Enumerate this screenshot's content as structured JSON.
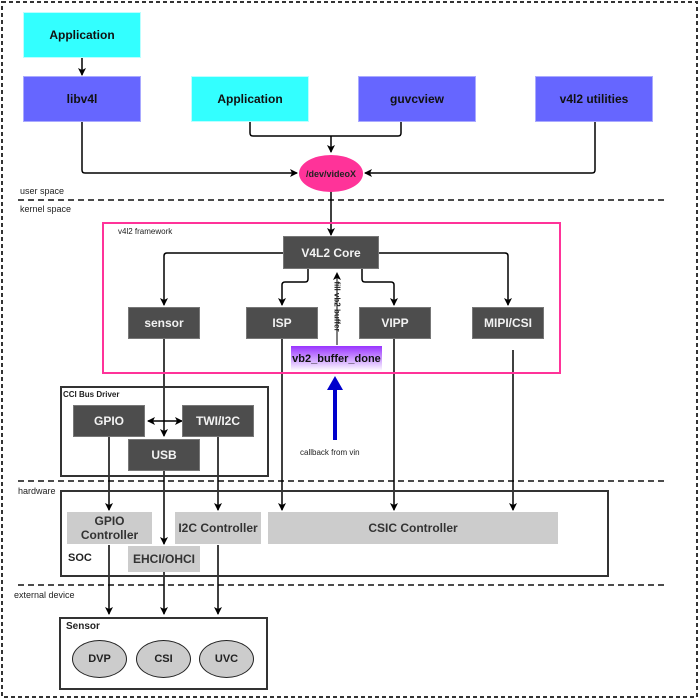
{
  "zones": {
    "user_space": "user space",
    "kernel_space": "kernel space",
    "hardware": "hardware",
    "external_device": "external device"
  },
  "user_space": {
    "app_top": "Application",
    "libv4l": "libv4l",
    "app_mid": "Application",
    "guvcview": "guvcview",
    "v4l2_utilities": "v4l2 utilities",
    "device_node": "/dev/videoX"
  },
  "framework": {
    "title": "v4l2 framework",
    "core": "V4L2 Core",
    "sensor": "sensor",
    "isp": "ISP",
    "vipp": "VIPP",
    "mipi_csi": "MIPI/CSI",
    "vb2_done": "vb2_buffer_done",
    "fill_label": "fill vb2 buffer",
    "callback_label": "callback from vin"
  },
  "cci": {
    "title": "CCI Bus Driver",
    "gpio": "GPIO",
    "twi_i2c": "TWI/I2C",
    "usb": "USB"
  },
  "soc": {
    "title": "SOC",
    "gpio_controller": "GPIO Controller",
    "i2c_controller": "I2C Controller",
    "csic_controller": "CSIC Controller",
    "ehci_ohci": "EHCI/OHCI"
  },
  "sensor_group": {
    "title": "Sensor",
    "items": [
      "DVP",
      "CSI",
      "UVC"
    ]
  },
  "colors": {
    "application": "#33ffff",
    "library": "#6666ff",
    "device_node": "#ff3399",
    "framework_border": "#ff3399",
    "module": "#4d4d4d",
    "controller": "#cccccc",
    "vb2_gradient_top": "#9933ff",
    "callback_arrow": "#0000cc"
  }
}
